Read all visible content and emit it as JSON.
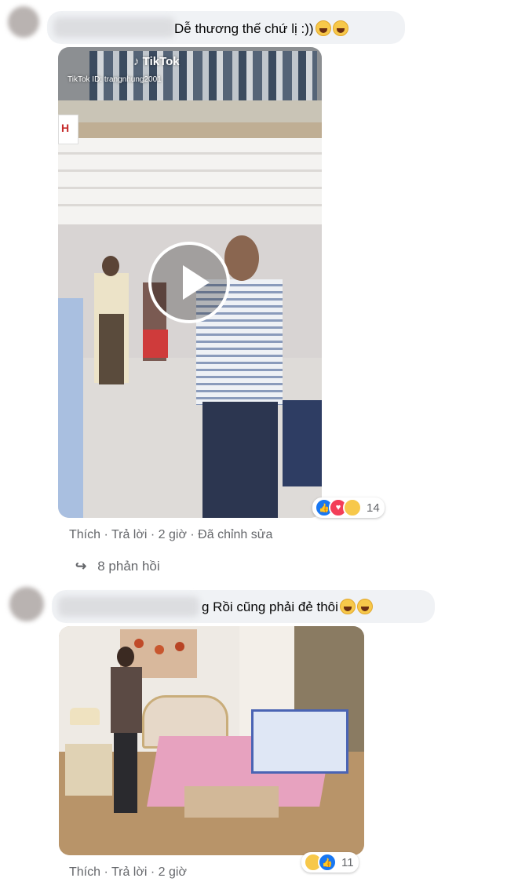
{
  "comment1": {
    "text": "Dễ thương thế chứ lị :))",
    "emojis": [
      "laughing-face",
      "laughing-face"
    ],
    "video": {
      "tiktok_logo": "TikTok",
      "tiktok_id": "TikTok ID: trangnhung2001"
    },
    "reactions": {
      "icons": [
        "like",
        "love",
        "haha"
      ],
      "count": "14"
    },
    "actions": {
      "like": "Thích",
      "reply": "Trả lời",
      "time": "2 giờ",
      "edited": "Đã chỉnh sửa",
      "separator": "·"
    },
    "replies": "8 phản hồi"
  },
  "comment2": {
    "text": "g Rồi cũng phải đẻ thôi",
    "emojis": [
      "rolling-laughing-face",
      "rolling-laughing-face"
    ],
    "reactions": {
      "icons": [
        "haha",
        "like"
      ],
      "count": "11"
    },
    "actions": {
      "like": "Thích",
      "reply": "Trả lời",
      "time": "2 giờ",
      "separator": "·"
    }
  },
  "colors": {
    "bubble": "#f0f2f5",
    "meta_text": "#65676b",
    "like_blue": "#1877f2",
    "love_red": "#f33e58",
    "haha_yellow": "#f7c84a"
  }
}
